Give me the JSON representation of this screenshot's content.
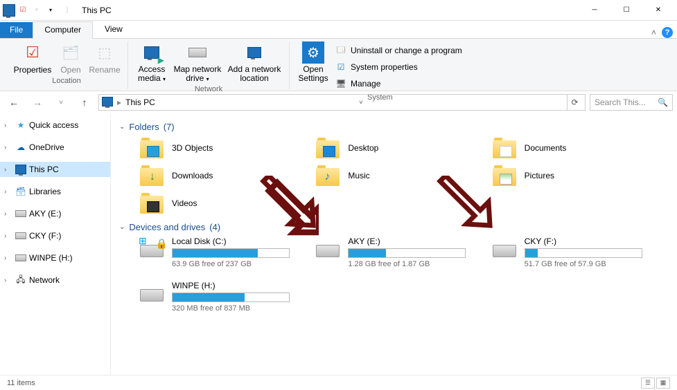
{
  "window": {
    "title": "This PC"
  },
  "menu": {
    "file": "File",
    "tabs": [
      "Computer",
      "View"
    ],
    "activeIndex": 0,
    "collapse": "˄",
    "help": "?"
  },
  "ribbon": {
    "location": {
      "properties": "Properties",
      "open": "Open",
      "rename": "Rename",
      "label": "Location"
    },
    "network": {
      "accessmedia": "Access media",
      "mapdrive": "Map network drive",
      "addlocation": "Add a network location",
      "label": "Network"
    },
    "system": {
      "opensettings": "Open Settings",
      "uninstall": "Uninstall or change a program",
      "sysprops": "System properties",
      "manage": "Manage",
      "label": "System"
    }
  },
  "address": {
    "location": "This PC",
    "searchPlaceholder": "Search This..."
  },
  "nav": {
    "quick": "Quick access",
    "onedrive": "OneDrive",
    "thispc": "This PC",
    "libraries": "Libraries",
    "aky": "AKY (E:)",
    "cky": "CKY (F:)",
    "winpe": "WINPE (H:)",
    "network": "Network"
  },
  "sections": {
    "folders": {
      "label": "Folders",
      "count": "(7)"
    },
    "drives": {
      "label": "Devices and drives",
      "count": "(4)"
    }
  },
  "folders": {
    "objects": "3D Objects",
    "desktop": "Desktop",
    "documents": "Documents",
    "downloads": "Downloads",
    "music": "Music",
    "pictures": "Pictures",
    "videos": "Videos"
  },
  "drives": {
    "c": {
      "name": "Local Disk (C:)",
      "free": "63.9 GB free of 237 GB",
      "fillpct": "73%"
    },
    "e": {
      "name": "AKY (E:)",
      "free": "1.28 GB free of 1.87 GB",
      "fillpct": "32%"
    },
    "f": {
      "name": "CKY (F:)",
      "free": "51.7 GB free of 57.9 GB",
      "fillpct": "11%"
    },
    "h": {
      "name": "WINPE (H:)",
      "free": "320 MB free of 837 MB",
      "fillpct": "62%"
    }
  },
  "status": {
    "items": "11 items"
  }
}
